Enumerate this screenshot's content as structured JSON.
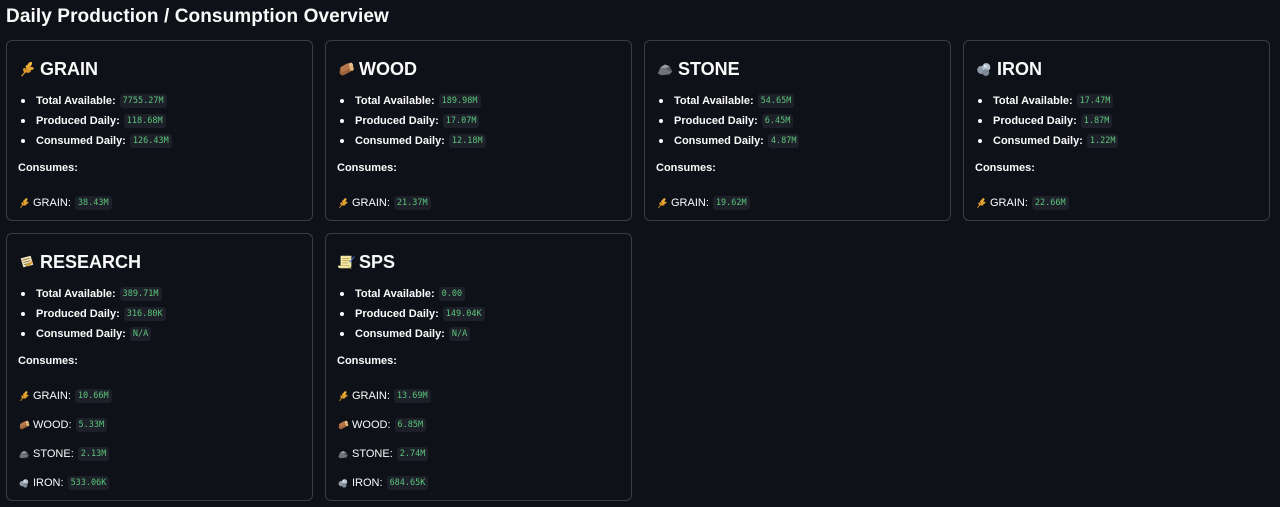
{
  "page": {
    "title": "Daily Production / Consumption Overview"
  },
  "labels": {
    "total_available": "Total Available:",
    "produced_daily": "Produced Daily:",
    "consumed_daily": "Consumed Daily:",
    "consumes": "Consumes:"
  },
  "cards": [
    {
      "name": "GRAIN",
      "icon": "grain-icon",
      "total_available": "7755.27M",
      "produced_daily": "118.68M",
      "consumed_daily": "126.43M",
      "consumes": [
        {
          "name": "GRAIN:",
          "icon": "grain-icon",
          "value": "38.43M"
        }
      ]
    },
    {
      "name": "WOOD",
      "icon": "wood-icon",
      "total_available": "189.98M",
      "produced_daily": "17.07M",
      "consumed_daily": "12.18M",
      "consumes": [
        {
          "name": "GRAIN:",
          "icon": "grain-icon",
          "value": "21.37M"
        }
      ]
    },
    {
      "name": "STONE",
      "icon": "stone-icon",
      "total_available": "54.65M",
      "produced_daily": "6.45M",
      "consumed_daily": "4.87M",
      "consumes": [
        {
          "name": "GRAIN:",
          "icon": "grain-icon",
          "value": "19.62M"
        }
      ]
    },
    {
      "name": "IRON",
      "icon": "iron-icon",
      "total_available": "17.47M",
      "produced_daily": "1.87M",
      "consumed_daily": "1.22M",
      "consumes": [
        {
          "name": "GRAIN:",
          "icon": "grain-icon",
          "value": "22.66M"
        }
      ]
    },
    {
      "name": "RESEARCH",
      "icon": "research-icon",
      "total_available": "389.71M",
      "produced_daily": "316.80K",
      "consumed_daily": "N/A",
      "consumes": [
        {
          "name": "GRAIN:",
          "icon": "grain-icon",
          "value": "10.66M"
        },
        {
          "name": "WOOD:",
          "icon": "wood-icon",
          "value": "5.33M"
        },
        {
          "name": "STONE:",
          "icon": "stone-icon",
          "value": "2.13M"
        },
        {
          "name": "IRON:",
          "icon": "iron-icon",
          "value": "533.06K"
        }
      ]
    },
    {
      "name": "SPS",
      "icon": "sps-icon",
      "total_available": "0.00",
      "produced_daily": "149.04K",
      "consumed_daily": "N/A",
      "consumes": [
        {
          "name": "GRAIN:",
          "icon": "grain-icon",
          "value": "13.69M"
        },
        {
          "name": "WOOD:",
          "icon": "wood-icon",
          "value": "6.85M"
        },
        {
          "name": "STONE:",
          "icon": "stone-icon",
          "value": "2.74M"
        },
        {
          "name": "IRON:",
          "icon": "iron-icon",
          "value": "684.65K"
        }
      ]
    }
  ],
  "colors": {
    "background": "#0e1117",
    "card_border": "#3a3d46",
    "code_text": "#5bc47a",
    "code_background": "#1d2029",
    "text": "#fafafa"
  }
}
